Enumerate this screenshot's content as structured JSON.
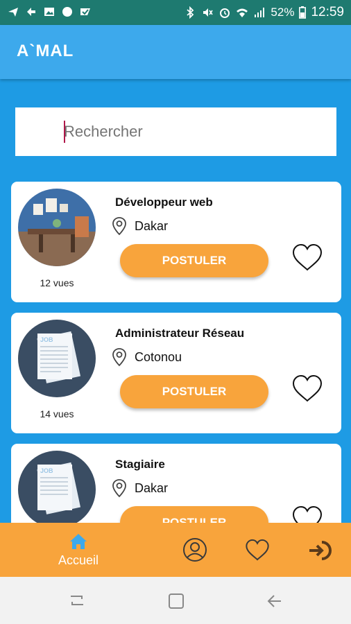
{
  "status_bar": {
    "battery": "52%",
    "time": "12:59"
  },
  "app": {
    "title": "A`MAL"
  },
  "search": {
    "placeholder": "Rechercher"
  },
  "jobs": [
    {
      "title": "Développeur web",
      "location": "Dakar",
      "views": "12 vues",
      "apply_label": "POSTULER",
      "thumb_icon": "office-photo"
    },
    {
      "title": "Administrateur Réseau",
      "location": "Cotonou",
      "views": "14 vues",
      "apply_label": "POSTULER",
      "thumb_icon": "job-documents-icon"
    },
    {
      "title": "Stagiaire",
      "location": "Dakar",
      "views": "",
      "apply_label": "POSTULER",
      "thumb_icon": "job-documents-icon"
    }
  ],
  "bottom_nav": {
    "home_label": "Accueil",
    "icons": [
      "home-icon",
      "profile-icon",
      "favorites-icon",
      "logout-icon"
    ]
  },
  "colors": {
    "background": "#1E9BE4",
    "app_bar": "#3DA9EC",
    "status_bar": "#1E7A70",
    "accent": "#F8A43C",
    "card": "#FFFFFF"
  }
}
